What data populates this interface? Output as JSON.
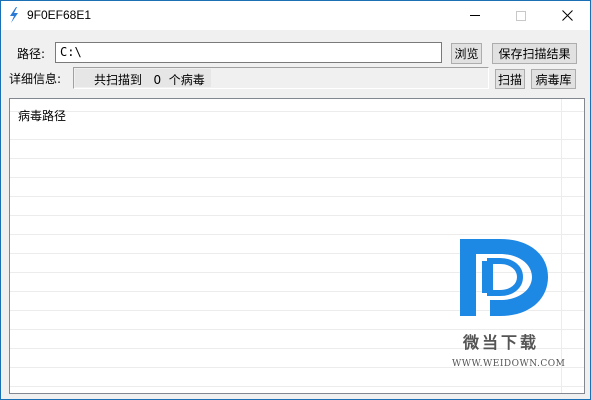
{
  "window": {
    "title": "9F0EF68E1",
    "icon": "lightning-bolt-icon",
    "controls": [
      "minimize-icon",
      "maximize-icon",
      "close-icon"
    ]
  },
  "path_row": {
    "label": "路径:",
    "value": "C:\\",
    "browse_label": "浏览",
    "save_label": "保存扫描结果"
  },
  "detail_row": {
    "label": "详细信息:",
    "status_text": "共扫描到   0  个病毒",
    "scan_label": "扫描",
    "virus_db_label": "病毒库"
  },
  "list": {
    "header": "病毒路径",
    "rows": []
  },
  "watermark": {
    "title": "微当下载",
    "url": "WWW.WEIDOWN.COM",
    "color": "#1e88e5"
  },
  "colors": {
    "accent": "#1a6fb5",
    "button_bg": "#e1e1e1",
    "window_bg": "#f0f0f0"
  }
}
